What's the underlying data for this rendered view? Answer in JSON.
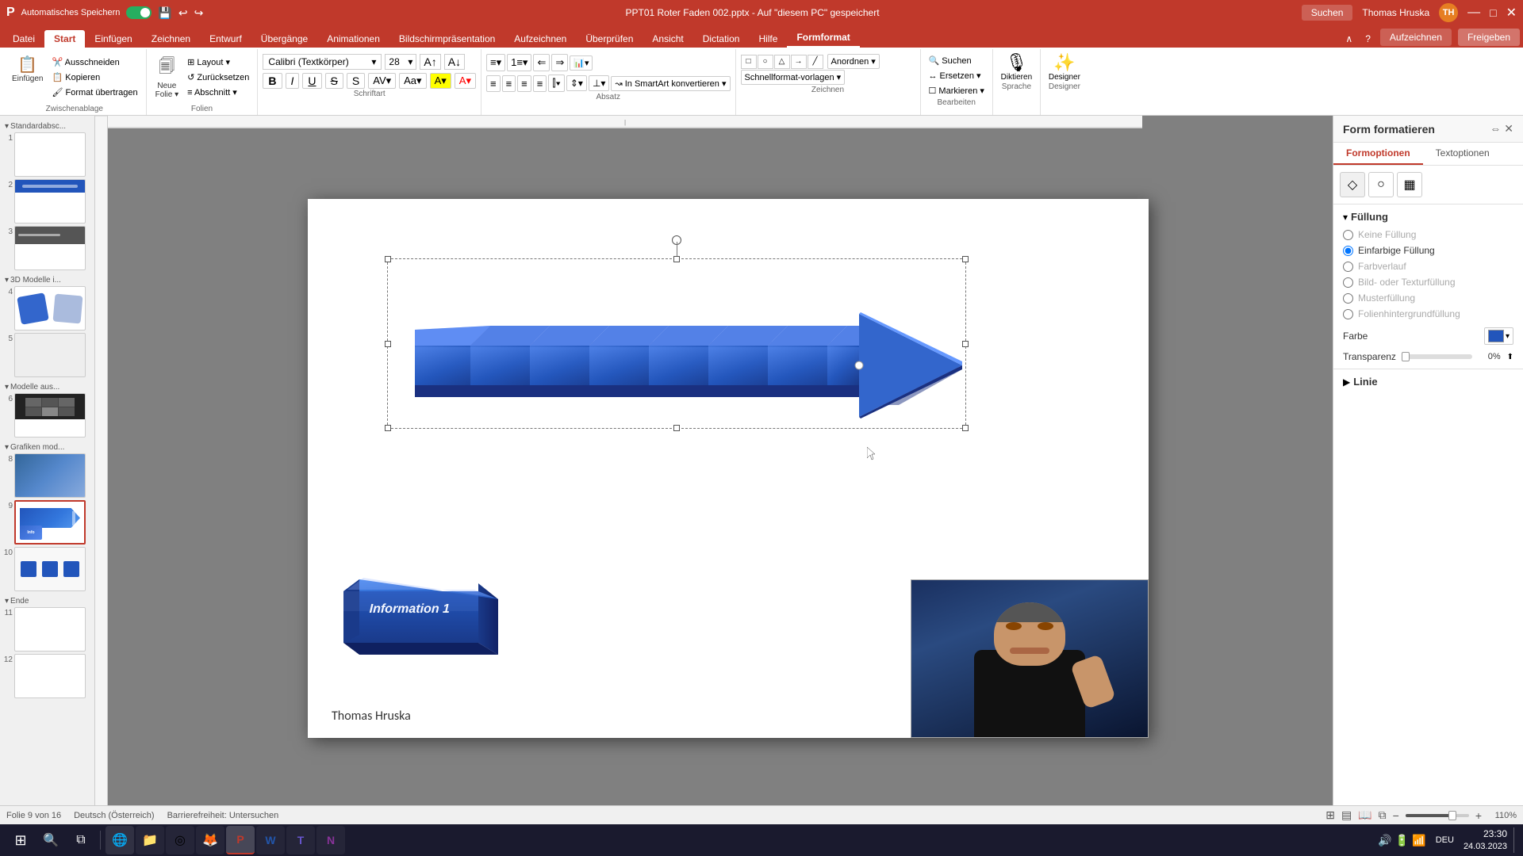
{
  "app": {
    "title": "PPT01 Roter Faden 002.pptx - Auf \"diesem PC\" gespeichert",
    "auto_save_label": "Automatisches Speichern",
    "user": "Thomas Hruska",
    "version": "PowerPoint"
  },
  "ribbon_tabs": [
    {
      "label": "Datei",
      "active": false
    },
    {
      "label": "Start",
      "active": true
    },
    {
      "label": "Einfügen",
      "active": false
    },
    {
      "label": "Zeichnen",
      "active": false
    },
    {
      "label": "Entwurf",
      "active": false
    },
    {
      "label": "Übergänge",
      "active": false
    },
    {
      "label": "Animationen",
      "active": false
    },
    {
      "label": "Bildschirmpräsentation",
      "active": false
    },
    {
      "label": "Aufzeichnen",
      "active": false
    },
    {
      "label": "Überprüfen",
      "active": false
    },
    {
      "label": "Ansicht",
      "active": false
    },
    {
      "label": "Dictation",
      "active": false
    },
    {
      "label": "Hilfe",
      "active": false
    },
    {
      "label": "Formformat",
      "active": true
    }
  ],
  "ribbon_groups": [
    {
      "label": "Zwischenablage"
    },
    {
      "label": "Folien"
    },
    {
      "label": "Schriftart"
    },
    {
      "label": "Absatz"
    },
    {
      "label": "Zeichnen"
    },
    {
      "label": "Bearbeiten"
    },
    {
      "label": "Sprache"
    },
    {
      "label": "Designer"
    }
  ],
  "font": {
    "name": "Calibri (Textkörper)",
    "size": "28"
  },
  "side_panel": {
    "title": "Form formatieren",
    "tabs": [
      {
        "label": "Formoptionen",
        "active": true
      },
      {
        "label": "Textoptionen",
        "active": false
      }
    ],
    "icons": [
      {
        "name": "fill-icon",
        "symbol": "◇"
      },
      {
        "name": "effects-icon",
        "symbol": "○"
      },
      {
        "name": "size-icon",
        "symbol": "▦"
      }
    ],
    "sections": {
      "fill": {
        "title": "Füllung",
        "options": [
          {
            "label": "Keine Füllung",
            "checked": false
          },
          {
            "label": "Einfarbige Füllung",
            "checked": true
          },
          {
            "label": "Farbverlauf",
            "checked": false
          },
          {
            "label": "Bild- oder Texturfüllung",
            "checked": false
          },
          {
            "label": "Musterfüllung",
            "checked": false
          },
          {
            "label": "Folienhintergrundfüllung",
            "checked": false
          }
        ],
        "color_label": "Farbe",
        "transparency_label": "Transparenz",
        "transparency_value": "0%"
      },
      "line": {
        "title": "Linie"
      }
    }
  },
  "slide": {
    "arrow_shape": {
      "description": "3D blue arrow with chevron segments"
    },
    "key_button": {
      "text": "Information 1"
    },
    "author": "Thomas Hruska"
  },
  "status_bar": {
    "slide_info": "Folie 9 von 16",
    "language": "Deutsch (Österreich)",
    "accessibility": "Barrierefreiheit: Untersuchen",
    "zoom": "110%"
  },
  "slides": [
    {
      "num": "1",
      "group": "",
      "active": false
    },
    {
      "num": "2",
      "group": "",
      "active": false
    },
    {
      "num": "3",
      "group": "",
      "active": false
    },
    {
      "num": "3D Modelle i...",
      "group": true,
      "active": false
    },
    {
      "num": "4",
      "group": "",
      "active": false
    },
    {
      "num": "5",
      "group": "",
      "active": false
    },
    {
      "num": "Modelle aus...",
      "group": true,
      "active": false
    },
    {
      "num": "6",
      "group": "",
      "active": false
    },
    {
      "num": "9",
      "group": "",
      "active": true
    },
    {
      "num": "10",
      "group": "",
      "active": false
    },
    {
      "num": "Ende",
      "group": true,
      "active": false
    },
    {
      "num": "11",
      "group": "",
      "active": false
    },
    {
      "num": "12",
      "group": "",
      "active": false
    }
  ],
  "webcam": {
    "time": "23:30",
    "date": "24.03.2023"
  },
  "taskbar": {
    "items": [
      {
        "name": "start-icon",
        "symbol": "⊞"
      },
      {
        "name": "search-icon",
        "symbol": "🔍"
      },
      {
        "name": "taskview-icon",
        "symbol": "⧉"
      },
      {
        "name": "edge-icon",
        "symbol": "🌐"
      },
      {
        "name": "explorer-icon",
        "symbol": "📁"
      },
      {
        "name": "chrome-icon",
        "symbol": "◎"
      },
      {
        "name": "powerpoint-icon",
        "symbol": "P"
      },
      {
        "name": "word-icon",
        "symbol": "W"
      }
    ],
    "time": "23:30",
    "date": "24.03.2023",
    "language": "DEU"
  },
  "colors": {
    "accent_red": "#c0392b",
    "accent_blue": "#2255bb",
    "arrow_blue": "#2255cc",
    "arrow_blue_dark": "#1a3a8a",
    "panel_bg": "#f8f8f8"
  }
}
